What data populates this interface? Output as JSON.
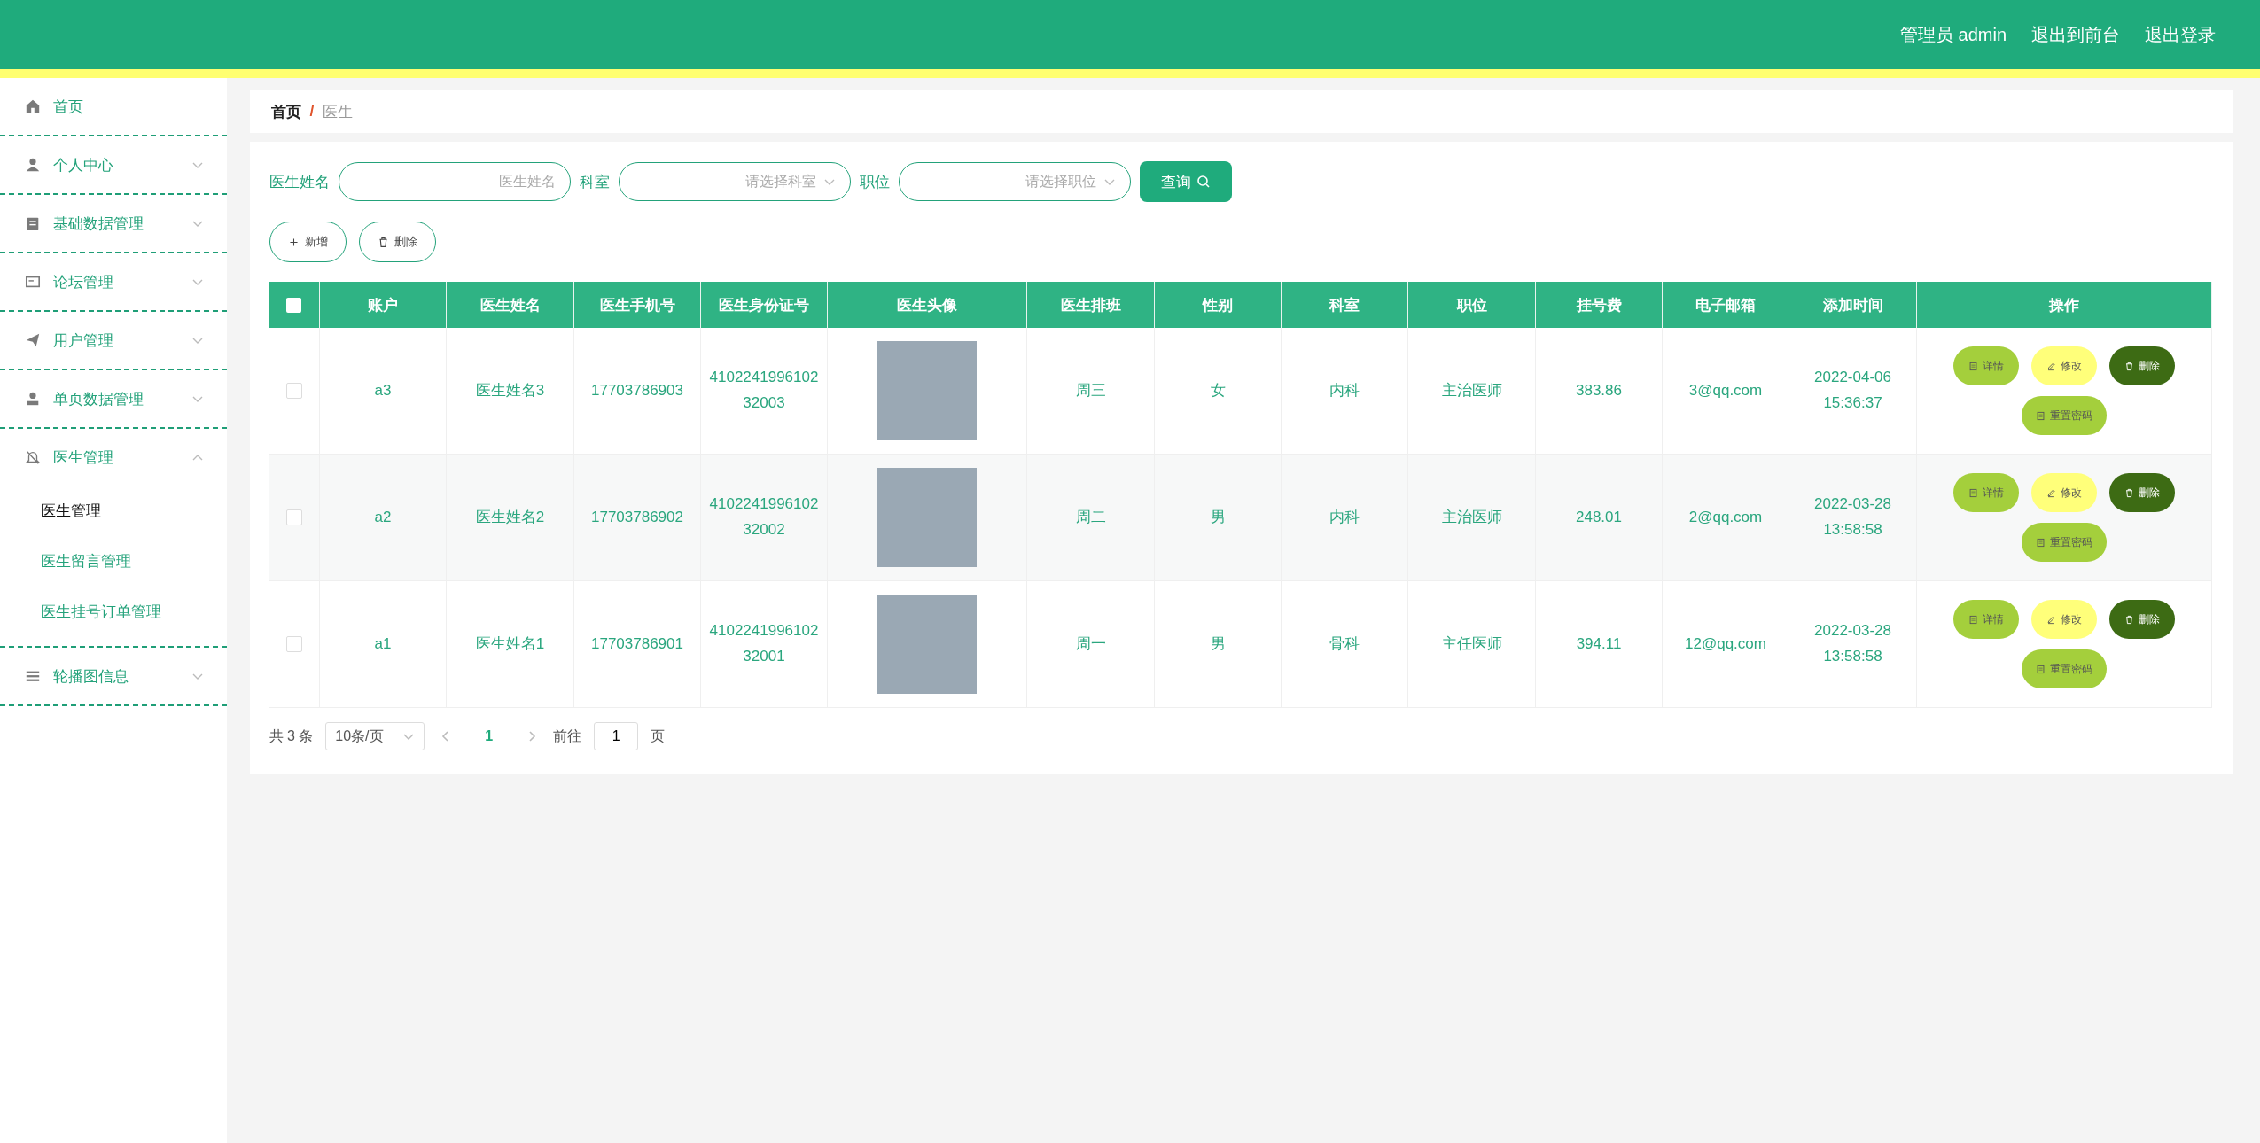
{
  "header": {
    "user": "管理员 admin",
    "links": [
      "退出到前台",
      "退出登录"
    ]
  },
  "sidebar": {
    "items": [
      {
        "label": "首页",
        "kind": "link",
        "expanded": false
      },
      {
        "label": "个人中心",
        "kind": "menu",
        "expanded": false
      },
      {
        "label": "基础数据管理",
        "kind": "menu",
        "expanded": false
      },
      {
        "label": "论坛管理",
        "kind": "menu",
        "expanded": false
      },
      {
        "label": "用户管理",
        "kind": "menu",
        "expanded": false
      },
      {
        "label": "单页数据管理",
        "kind": "menu",
        "expanded": false
      },
      {
        "label": "医生管理",
        "kind": "menu",
        "expanded": true,
        "children": [
          {
            "label": "医生管理",
            "selected": true
          },
          {
            "label": "医生留言管理",
            "selected": false
          },
          {
            "label": "医生挂号订单管理",
            "selected": false
          }
        ]
      },
      {
        "label": "轮播图信息",
        "kind": "menu",
        "expanded": false
      }
    ]
  },
  "breadcrumb": [
    "首页",
    "/",
    "医生"
  ],
  "search": {
    "fields": [
      {
        "label": "医生姓名",
        "kind": "input",
        "placeholder": "医生姓名"
      },
      {
        "label": "科室",
        "kind": "select",
        "placeholder": "请选择科室"
      },
      {
        "label": "职位",
        "kind": "select",
        "placeholder": "请选择职位"
      }
    ],
    "button": "查询"
  },
  "toolbar": [
    {
      "kind": "add",
      "label": "新增"
    },
    {
      "kind": "delete",
      "label": "删除"
    }
  ],
  "table": {
    "select_all": {
      "checked": false
    },
    "columns": [
      "账户",
      "医生姓名",
      "医生手机号",
      "医生身份证号",
      "医生头像",
      "医生排班",
      "性别",
      "科室",
      "职位",
      "挂号费",
      "电子邮箱",
      "添加时间",
      "操作"
    ],
    "rows": [
      {
        "checked": false,
        "cells": [
          "a3",
          "医生姓名3",
          "17703786903",
          "410224199610232003",
          null,
          "周三",
          "女",
          "内科",
          "主治医师",
          "383.86",
          "3@qq.com",
          "2022-04-06 15:36:37"
        ],
        "actions": [
          {
            "kind": "detail",
            "label": "详情"
          },
          {
            "kind": "edit",
            "label": "修改"
          },
          {
            "kind": "delete",
            "label": "删除"
          },
          {
            "kind": "reset",
            "label": "重置密码"
          }
        ]
      },
      {
        "checked": false,
        "cells": [
          "a2",
          "医生姓名2",
          "17703786902",
          "410224199610232002",
          null,
          "周二",
          "男",
          "内科",
          "主治医师",
          "248.01",
          "2@qq.com",
          "2022-03-28 13:58:58"
        ],
        "actions": [
          {
            "kind": "detail",
            "label": "详情"
          },
          {
            "kind": "edit",
            "label": "修改"
          },
          {
            "kind": "delete",
            "label": "删除"
          },
          {
            "kind": "reset",
            "label": "重置密码"
          }
        ]
      },
      {
        "checked": false,
        "cells": [
          "a1",
          "医生姓名1",
          "17703786901",
          "410224199610232001",
          null,
          "周一",
          "男",
          "骨科",
          "主任医师",
          "394.11",
          "12@qq.com",
          "2022-03-28 13:58:58"
        ],
        "actions": [
          {
            "kind": "detail",
            "label": "详情"
          },
          {
            "kind": "edit",
            "label": "修改"
          },
          {
            "kind": "delete",
            "label": "删除"
          },
          {
            "kind": "reset",
            "label": "重置密码"
          }
        ]
      }
    ]
  },
  "pagination": {
    "total": "共 3 条",
    "page_size": "10条/页",
    "pages": [
      {
        "label": "1",
        "selected": true
      }
    ],
    "goto_label": "前往",
    "goto_value": "1",
    "goto_suffix": "页"
  }
}
